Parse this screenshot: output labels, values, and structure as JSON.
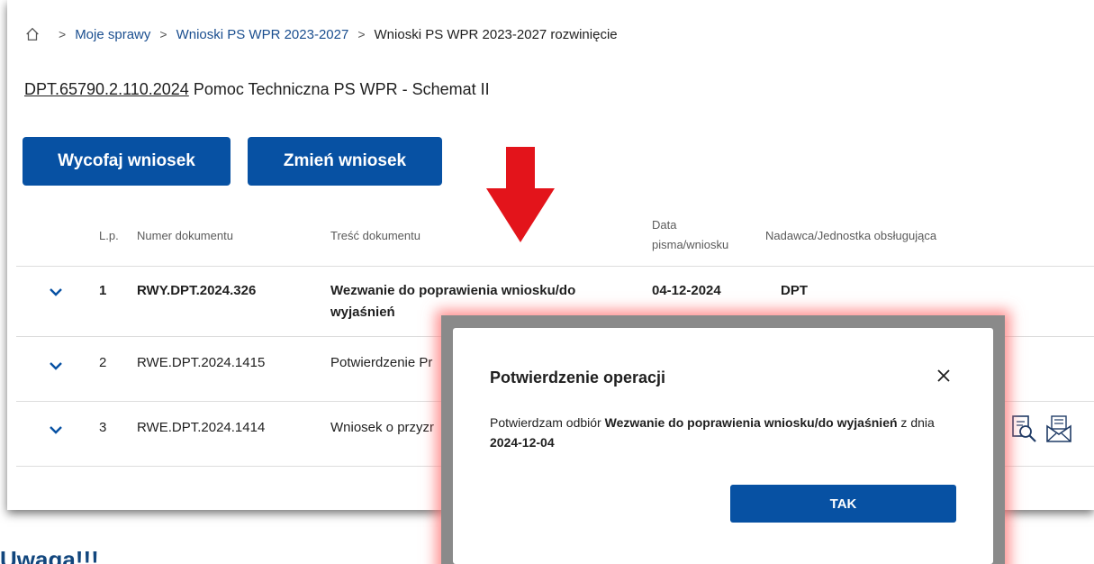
{
  "breadcrumb": {
    "items": [
      "Moje sprawy",
      "Wnioski PS WPR 2023-2027",
      "Wnioski PS WPR 2023-2027 rozwinięcie"
    ],
    "separator": ">"
  },
  "case": {
    "number": "DPT.65790.2.110.2024",
    "title": "Pomoc Techniczna PS WPR - Schemat II"
  },
  "actions": {
    "withdraw_label": "Wycofaj wniosek",
    "change_label": "Zmień wniosek"
  },
  "table": {
    "headers": {
      "lp": "L.p.",
      "number": "Numer dokumentu",
      "content": "Treść dokumentu",
      "date_line1": "Data",
      "date_line2": "pisma/wniosku",
      "sender": "Nadawca/Jednostka obsługująca"
    },
    "rows": [
      {
        "lp": "1",
        "number": "RWY.DPT.2024.326",
        "content_line1": "Wezwanie do poprawienia wniosku/do",
        "content_line2": "wyjaśnień",
        "date": "04-12-2024",
        "sender": "DPT",
        "bold": true
      },
      {
        "lp": "2",
        "number": "RWE.DPT.2024.1415",
        "content": "Potwierdzenie Pr",
        "bold": false
      },
      {
        "lp": "3",
        "number": "RWE.DPT.2024.1414",
        "content": "Wniosek o przyzr",
        "bold": false
      }
    ]
  },
  "warning": {
    "text": "Uwaga!!!"
  },
  "modal": {
    "title": "Potwierdzenie operacji",
    "body_prefix": "Potwierdzam odbiór ",
    "body_doc": "Wezwanie do poprawienia wniosku/do wyjaśnień",
    "body_mid": " z dnia ",
    "body_date": "2024-12-04",
    "confirm_label": "TAK"
  },
  "colors": {
    "primary": "#0751a3",
    "link": "#1a4e8f",
    "arrow": "#e3141b",
    "glow": "#ff6e6e"
  },
  "icons": [
    "home-icon",
    "chevron-down-icon",
    "search-document-icon",
    "envelope-icon",
    "close-icon"
  ]
}
